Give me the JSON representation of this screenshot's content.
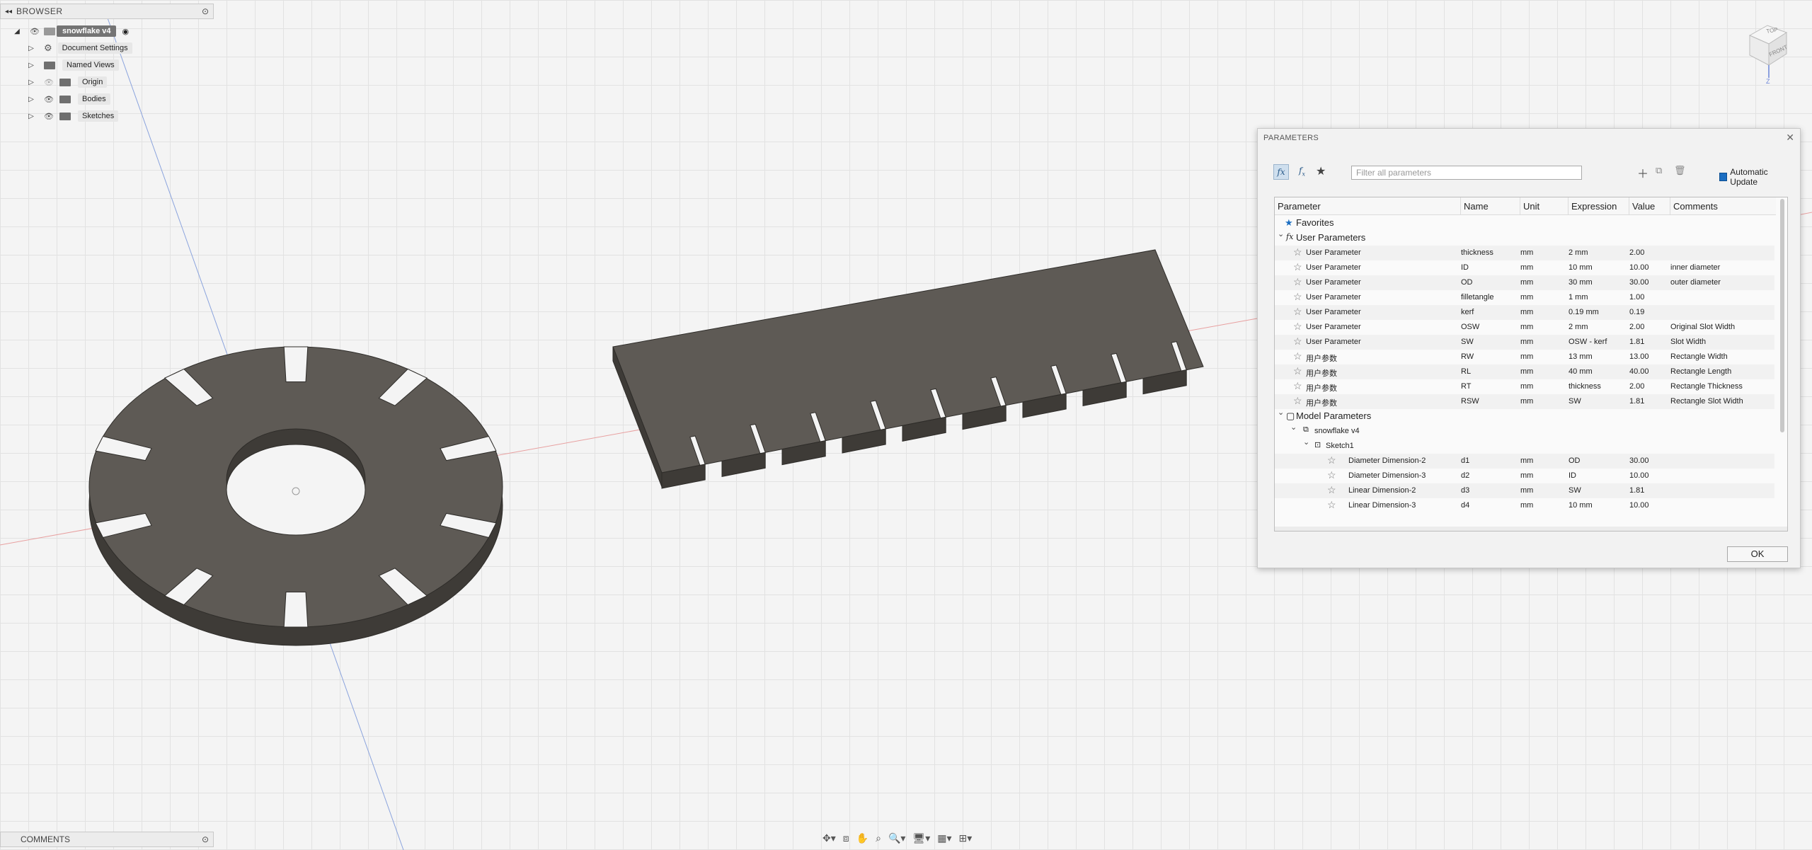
{
  "browser": {
    "title": "BROWSER",
    "root": "snowflake v4",
    "items": [
      {
        "label": "Document Settings",
        "icon": "gear-icon"
      },
      {
        "label": "Named Views",
        "icon": "folder-icon"
      },
      {
        "label": "Origin",
        "icon": "folder-icon"
      },
      {
        "label": "Bodies",
        "icon": "folder-icon"
      },
      {
        "label": "Sketches",
        "icon": "folder-icon"
      }
    ]
  },
  "comments": {
    "title": "COMMENTS"
  },
  "viewcube": {
    "top": "TOP",
    "front": "FRONT",
    "axis_z": "Z"
  },
  "parameters_dialog": {
    "title": "PARAMETERS",
    "search_placeholder": "Filter all parameters",
    "auto_update_label": "Automatic Update",
    "ok_label": "OK",
    "columns": [
      "Parameter",
      "Name",
      "Unit",
      "Expression",
      "Value",
      "Comments"
    ],
    "favorites_label": "Favorites",
    "user_params_label": "User Parameters",
    "user_params": [
      {
        "param": "User Parameter",
        "name": "thickness",
        "unit": "mm",
        "expr": "2 mm",
        "value": "2.00",
        "comment": ""
      },
      {
        "param": "User Parameter",
        "name": "ID",
        "unit": "mm",
        "expr": "10 mm",
        "value": "10.00",
        "comment": "inner diameter"
      },
      {
        "param": "User Parameter",
        "name": "OD",
        "unit": "mm",
        "expr": "30 mm",
        "value": "30.00",
        "comment": "outer diameter"
      },
      {
        "param": "User Parameter",
        "name": "filletangle",
        "unit": "mm",
        "expr": "1 mm",
        "value": "1.00",
        "comment": ""
      },
      {
        "param": "User Parameter",
        "name": "kerf",
        "unit": "mm",
        "expr": "0.19 mm",
        "value": "0.19",
        "comment": ""
      },
      {
        "param": "User Parameter",
        "name": "OSW",
        "unit": "mm",
        "expr": "2 mm",
        "value": "2.00",
        "comment": "Original Slot Width"
      },
      {
        "param": "User Parameter",
        "name": "SW",
        "unit": "mm",
        "expr": "OSW - kerf",
        "value": "1.81",
        "comment": "Slot Width"
      },
      {
        "param": "用户参数",
        "name": "RW",
        "unit": "mm",
        "expr": "13 mm",
        "value": "13.00",
        "comment": "Rectangle Width"
      },
      {
        "param": "用户参数",
        "name": "RL",
        "unit": "mm",
        "expr": "40 mm",
        "value": "40.00",
        "comment": "Rectangle Length"
      },
      {
        "param": "用户参数",
        "name": "RT",
        "unit": "mm",
        "expr": "thickness",
        "value": "2.00",
        "comment": "Rectangle Thickness"
      },
      {
        "param": "用户参数",
        "name": "RSW",
        "unit": "mm",
        "expr": "SW",
        "value": "1.81",
        "comment": "Rectangle Slot Width"
      }
    ],
    "model_params_label": "Model Parameters",
    "model_component": "snowflake v4",
    "model_sketch": "Sketch1",
    "model_params": [
      {
        "param": "Diameter Dimension-2",
        "name": "d1",
        "unit": "mm",
        "expr": "OD",
        "value": "30.00"
      },
      {
        "param": "Diameter Dimension-3",
        "name": "d2",
        "unit": "mm",
        "expr": "ID",
        "value": "10.00"
      },
      {
        "param": "Linear Dimension-2",
        "name": "d3",
        "unit": "mm",
        "expr": "SW",
        "value": "1.81"
      },
      {
        "param": "Linear Dimension-3",
        "name": "d4",
        "unit": "mm",
        "expr": "10 mm",
        "value": "10.00"
      }
    ]
  },
  "colors": {
    "body_fill": "#5e5a55",
    "body_side": "#3e3b37",
    "grid": "#e2e2e2",
    "accent": "#1b6ec2"
  }
}
